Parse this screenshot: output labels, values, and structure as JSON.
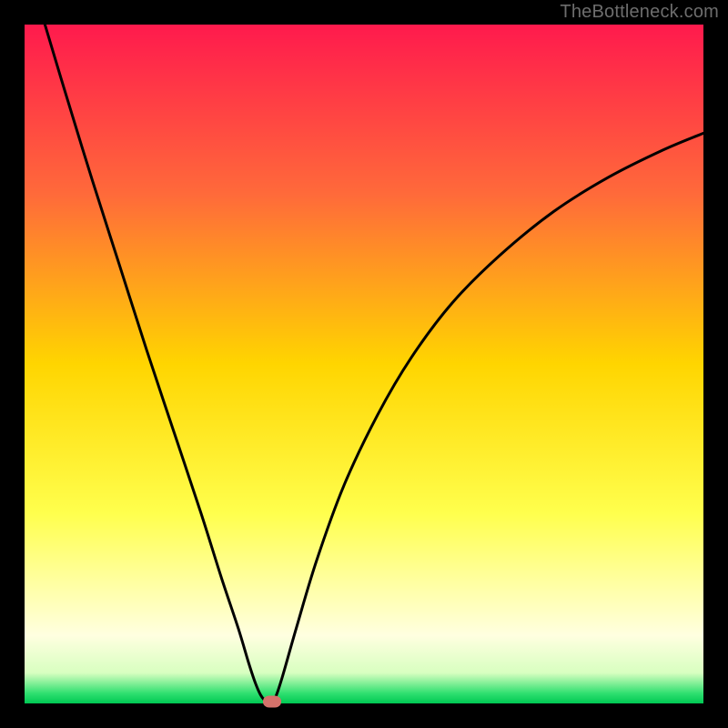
{
  "watermark": "TheBottleneck.com",
  "chart_data": {
    "type": "line",
    "title": "",
    "xlabel": "",
    "ylabel": "",
    "xlim": [
      0,
      100
    ],
    "ylim": [
      0,
      100
    ],
    "grid": false,
    "legend": false,
    "background_gradient": {
      "stops": [
        {
          "pos": 0.0,
          "color": "#ff1a4d"
        },
        {
          "pos": 0.25,
          "color": "#ff6a3a"
        },
        {
          "pos": 0.5,
          "color": "#ffd500"
        },
        {
          "pos": 0.72,
          "color": "#ffff4d"
        },
        {
          "pos": 0.82,
          "color": "#ffffa0"
        },
        {
          "pos": 0.9,
          "color": "#ffffe0"
        },
        {
          "pos": 0.955,
          "color": "#d8ffc0"
        },
        {
          "pos": 0.985,
          "color": "#30e070"
        },
        {
          "pos": 1.0,
          "color": "#00c853"
        }
      ]
    },
    "series": [
      {
        "name": "bottleneck-curve",
        "stroke": "#000000",
        "stroke_width": 3,
        "x": [
          3.0,
          6.0,
          10.0,
          14.0,
          18.0,
          22.0,
          26.0,
          29.0,
          31.5,
          33.0,
          34.0,
          34.8,
          35.6,
          36.4,
          37.0,
          38.0,
          40.0,
          43.0,
          47.0,
          52.0,
          57.0,
          63.0,
          70.0,
          78.0,
          86.0,
          94.0,
          100.0
        ],
        "y": [
          100.0,
          90.0,
          77.0,
          64.5,
          52.0,
          40.0,
          28.0,
          18.5,
          11.0,
          6.0,
          3.0,
          1.2,
          0.3,
          0.3,
          1.0,
          4.0,
          11.0,
          21.0,
          32.0,
          42.5,
          51.0,
          59.0,
          66.0,
          72.5,
          77.5,
          81.5,
          84.0
        ]
      }
    ],
    "marker": {
      "x": 36.4,
      "y": 0.3,
      "color": "#d4726b"
    }
  }
}
